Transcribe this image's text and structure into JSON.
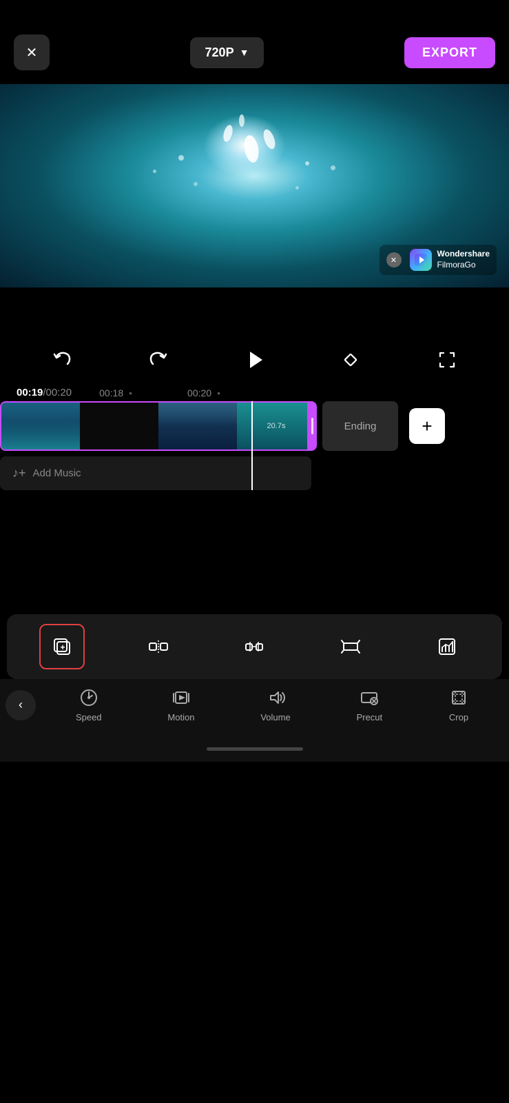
{
  "topBar": {
    "closeLabel": "✕",
    "qualityLabel": "720P",
    "qualityArrow": "▼",
    "exportLabel": "EXPORT"
  },
  "videoPreview": {
    "watermark": {
      "closeIcon": "✕",
      "brandText": "Wondershare\nFilmoraGo"
    }
  },
  "controls": {
    "undoIcon": "undo",
    "redoIcon": "redo",
    "playIcon": "play",
    "diamondIcon": "diamond",
    "cropIcon": "crop-frame"
  },
  "timeDisplay": {
    "current": "00:19",
    "total": "00:20",
    "marker1": "00:18",
    "marker2": "00:20"
  },
  "timeline": {
    "duration": "20.7s",
    "endingLabel": "Ending",
    "addClipLabel": "+",
    "addMusicLabel": "Add Music"
  },
  "toolRow": {
    "tools": [
      {
        "id": "copy",
        "label": "copy",
        "active": true
      },
      {
        "id": "split",
        "label": "split",
        "active": false
      },
      {
        "id": "mirror",
        "label": "mirror",
        "active": false
      },
      {
        "id": "trim",
        "label": "trim",
        "active": false
      },
      {
        "id": "replace",
        "label": "replace",
        "active": false
      }
    ]
  },
  "bottomNav": {
    "backLabel": "<",
    "items": [
      {
        "id": "speed",
        "label": "Speed"
      },
      {
        "id": "motion",
        "label": "Motion"
      },
      {
        "id": "volume",
        "label": "Volume"
      },
      {
        "id": "precut",
        "label": "Precut"
      },
      {
        "id": "crop",
        "label": "Crop"
      }
    ]
  }
}
